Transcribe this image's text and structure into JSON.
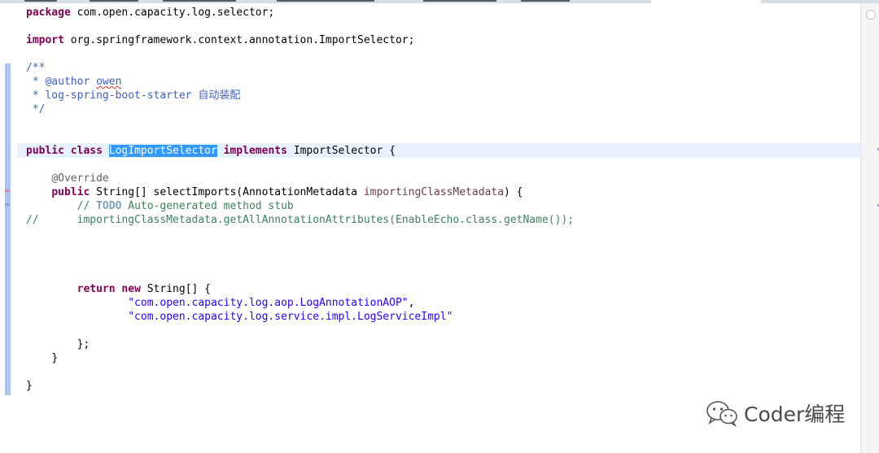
{
  "editor": {
    "package_keyword": "package",
    "package_name": " com.open.capacity.log.selector;",
    "import_keyword": "import",
    "import_name": " org.springframework.context.annotation.ImportSelector;",
    "javadoc": {
      "open": "/**",
      "author_tag": " * @author ",
      "author_name": "owen",
      "desc_line": " * log-spring-boot-starter 自动装配",
      "close": " */"
    },
    "class_decl": {
      "kw1": "public",
      "kw2": "class",
      "class_name": "LogImportSelector",
      "kw3": "implements",
      "iface": " ImportSelector {"
    },
    "override": "@Override",
    "method": {
      "kw": "public",
      "sig_a": " String[] selectImports(AnnotationMetadata ",
      "param": "importingClassMetadata",
      "sig_b": ") {"
    },
    "todo_prefix": "// ",
    "todo_word": "TODO",
    "todo_text": " Auto-generated method stub",
    "commented_code": "//      importingClassMetadata.getAllAnnotationAttributes(EnableEcho.class.getName());",
    "return_kw": "return",
    "new_kw": "new",
    "return_rest": " String[] {",
    "string1": "\"com.open.capacity.log.aop.LogAnnotationAOP\"",
    "string1_comma": ",",
    "string2": "\"com.open.capacity.log.service.impl.LogServiceImpl\"",
    "close_array": "};",
    "close_method": "}",
    "close_class": "}"
  },
  "watermark": {
    "text": "Coder编程",
    "icon": "wechat-icon"
  },
  "colors": {
    "keyword": "#7f0055",
    "javadoc": "#3f5fbf",
    "comment": "#3f7f5f",
    "string": "#2a00ff",
    "annotation": "#646464",
    "selection": "#3399ff",
    "current_line": "#e8f2fe"
  }
}
